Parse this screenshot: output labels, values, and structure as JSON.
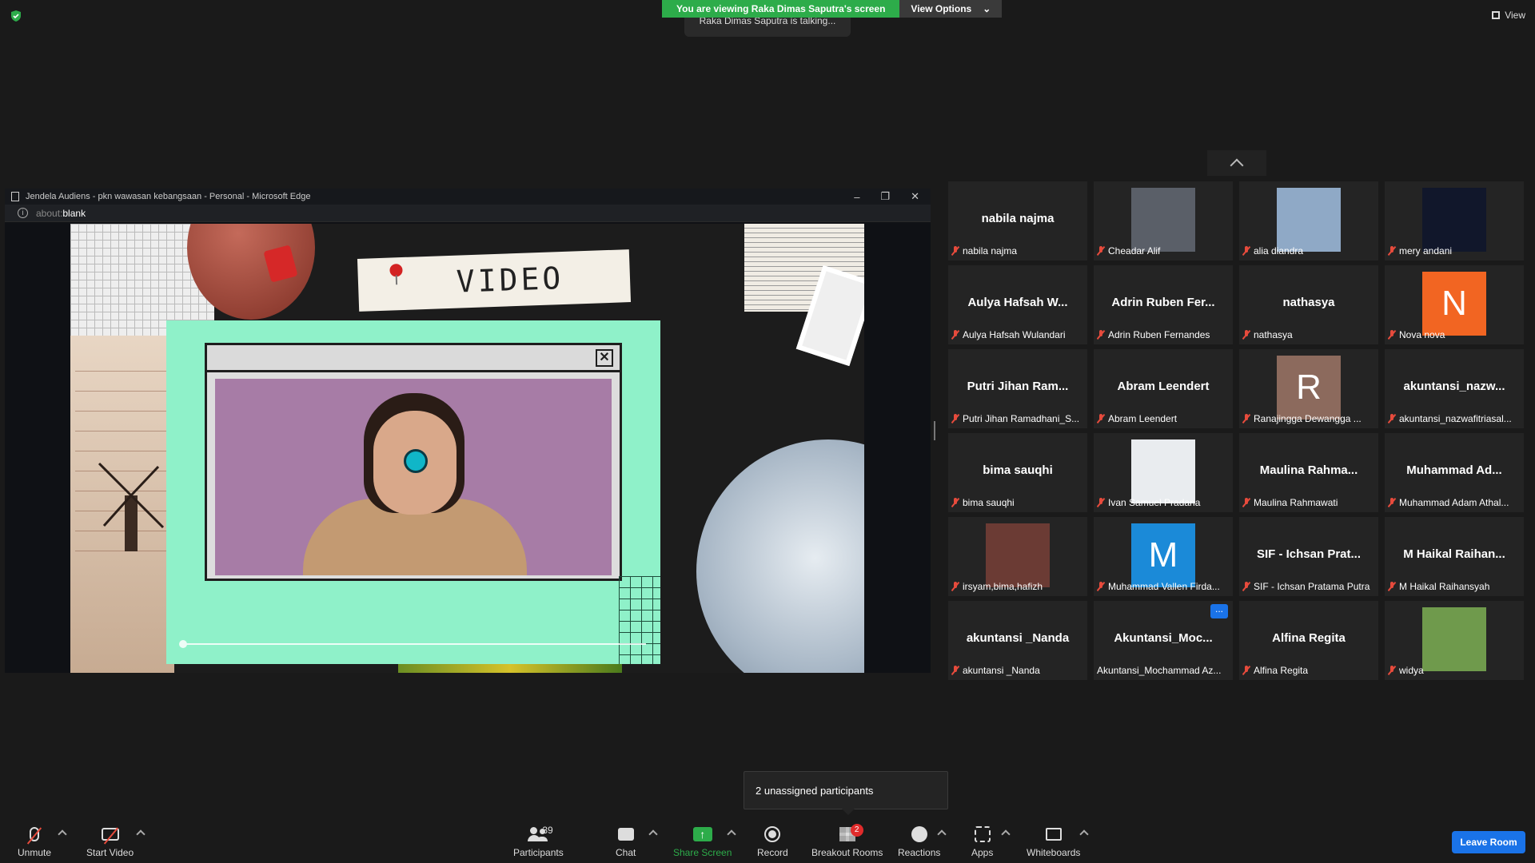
{
  "banner": {
    "viewing_text": "You are viewing Raka Dimas Saputra's screen",
    "view_options_label": "View Options",
    "talking_text": "Raka Dimas Saputra is talking...",
    "view_label": "View"
  },
  "edge_window": {
    "title": "Jendela Audiens - pkn wawasan kebangsaan - Personal - Microsoft Edge",
    "url_prefix": "about:",
    "url_main": "blank",
    "minimize": "–",
    "restore": "❐",
    "close": "✕"
  },
  "slide": {
    "heading": "VIDEO",
    "close_glyph": "✕",
    "progress_fraction": 0.0
  },
  "gallery": {
    "tiles": [
      {
        "big_name": "nabila najma",
        "label": "nabila najma",
        "avatar": null
      },
      {
        "big_name": "",
        "label": "Cheadar Alif",
        "avatar": {
          "type": "photo",
          "color": "#5a5f68"
        }
      },
      {
        "big_name": "",
        "label": "alia diandra",
        "avatar": {
          "type": "photo",
          "color": "#8fa9c6"
        }
      },
      {
        "big_name": "",
        "label": "mery andani",
        "avatar": {
          "type": "photo",
          "color": "#11172b"
        }
      },
      {
        "big_name": "Aulya Hafsah W...",
        "label": "Aulya Hafsah Wulandari",
        "avatar": null
      },
      {
        "big_name": "Adrin Ruben Fer...",
        "label": "Adrin Ruben Fernandes",
        "avatar": null
      },
      {
        "big_name": "nathasya",
        "label": "nathasya",
        "avatar": null
      },
      {
        "big_name": "",
        "label": "Nova nova",
        "avatar": {
          "type": "letter",
          "letter": "N",
          "color": "#f26522"
        }
      },
      {
        "big_name": "Putri Jihan Ram...",
        "label": "Putri Jihan Ramadhani_S...",
        "avatar": null
      },
      {
        "big_name": "Abram Leendert",
        "label": "Abram Leendert",
        "avatar": null
      },
      {
        "big_name": "",
        "label": "Ranajingga Dewangga ...",
        "avatar": {
          "type": "letter",
          "letter": "R",
          "color": "#8c6a5d"
        }
      },
      {
        "big_name": "akuntansi_nazw...",
        "label": "akuntansi_nazwafitriasal...",
        "avatar": null
      },
      {
        "big_name": "bima sauqhi",
        "label": "bima sauqhi",
        "avatar": null
      },
      {
        "big_name": "",
        "label": "Ivan Samuel Pradana",
        "avatar": {
          "type": "photo",
          "color": "#e9ecef"
        }
      },
      {
        "big_name": "Maulina Rahma...",
        "label": "Maulina Rahmawati",
        "avatar": null
      },
      {
        "big_name": "Muhammad Ad...",
        "label": "Muhammad Adam Athal...",
        "avatar": null
      },
      {
        "big_name": "",
        "label": "irsyam,bima,hafizh",
        "avatar": {
          "type": "photo",
          "color": "#6b3b34"
        }
      },
      {
        "big_name": "",
        "label": "Muhammad Vallen Firda...",
        "avatar": {
          "type": "letter",
          "letter": "M",
          "color": "#1b8ad8"
        }
      },
      {
        "big_name": "SIF - Ichsan Prat...",
        "label": "SIF - Ichsan Pratama Putra",
        "avatar": null
      },
      {
        "big_name": "M Haikal Raihan...",
        "label": "M Haikal Raihansyah",
        "avatar": null
      },
      {
        "big_name": "akuntansi _Nanda",
        "label": "akuntansi _Nanda",
        "avatar": null
      },
      {
        "big_name": "Akuntansi_Moc...",
        "label": "Akuntansi_Mochammad Az...",
        "avatar": null,
        "no_mute": true,
        "more": "..."
      },
      {
        "big_name": "Alfina Regita",
        "label": "Alfina Regita",
        "avatar": null
      },
      {
        "big_name": "",
        "label": "widya",
        "avatar": {
          "type": "photo",
          "color": "#6f9a4c"
        }
      }
    ]
  },
  "tooltip": {
    "unassigned_text": "2 unassigned participants"
  },
  "toolbar": {
    "unmute": "Unmute",
    "start_video": "Start Video",
    "participants": "Participants",
    "participants_count": "39",
    "chat": "Chat",
    "share_screen": "Share Screen",
    "share_glyph": "↑",
    "record": "Record",
    "breakout_rooms": "Breakout Rooms",
    "breakout_badge": "2",
    "reactions": "Reactions",
    "apps": "Apps",
    "whiteboards": "Whiteboards",
    "leave_room": "Leave Room"
  },
  "colors": {
    "share_green": "#2dac4a",
    "leave_blue": "#1a73e8",
    "mute_red": "#e74b3c",
    "slide_mint": "#8ff1c9",
    "video_purple": "#a77ca6"
  }
}
